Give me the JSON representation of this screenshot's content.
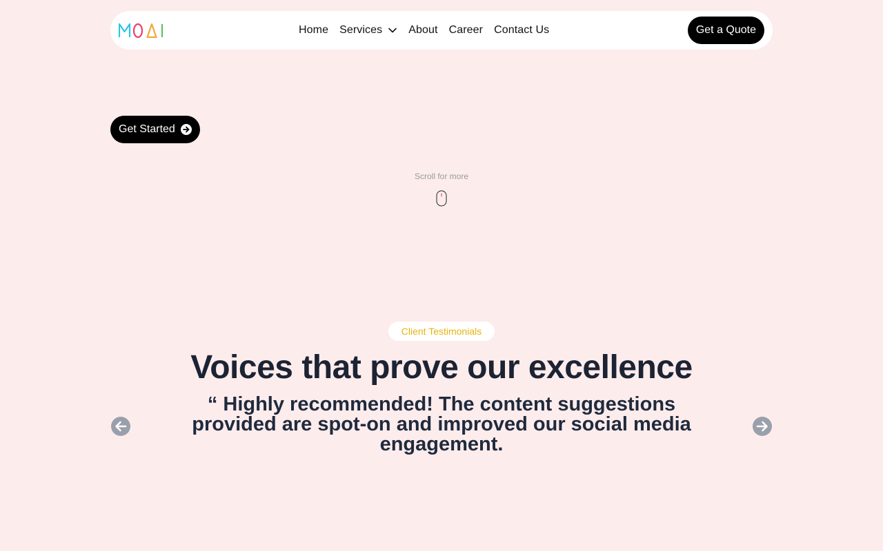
{
  "brand": {
    "logo_text": "MOAI",
    "logo_colors": [
      "#2ec4e6",
      "#e83e6c",
      "#f2a83b",
      "#5fbf63"
    ]
  },
  "nav": {
    "items": [
      {
        "label": "Home"
      },
      {
        "label": "Services",
        "has_dropdown": true
      },
      {
        "label": "About"
      },
      {
        "label": "Career"
      },
      {
        "label": "Contact Us"
      }
    ],
    "cta_label": "Get a Quote"
  },
  "hero": {
    "cta_label": "Get Started",
    "cta_icon": "arrow-right-circle-icon",
    "scroll_hint": "Scroll for more",
    "scroll_icon": "mouse-icon"
  },
  "testimonials": {
    "badge": "Client Testimonials",
    "title": "Voices that prove our excellence",
    "quote": "“ Highly recommended! The content suggestions provided are spot-on and improved our social media engagement.",
    "prev_icon": "arrow-left-circle-icon",
    "next_icon": "arrow-right-circle-icon"
  },
  "colors": {
    "background": "#fdecec",
    "primary_button": "#000000",
    "badge_text": "#e6b40f",
    "heading": "#1c2333",
    "carousel_arrow": "#9aa0ab"
  }
}
